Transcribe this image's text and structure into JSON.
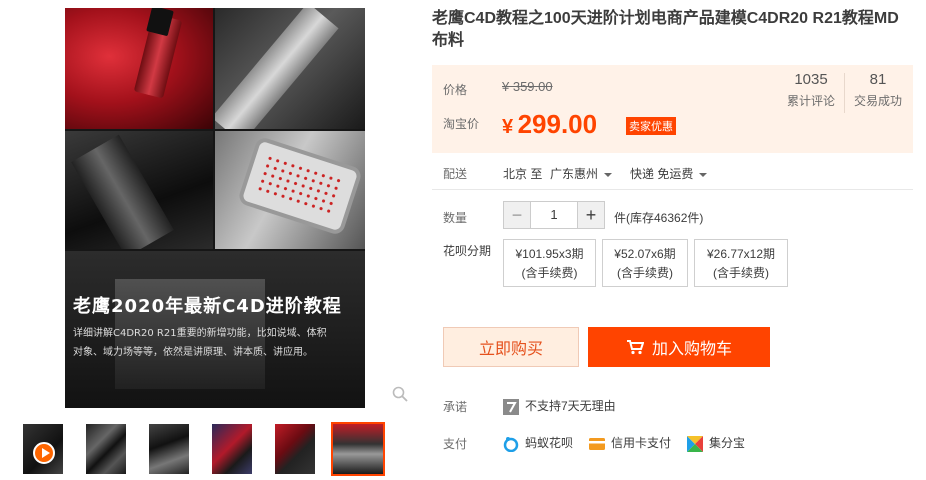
{
  "product": {
    "title": "老鹰C4D教程之100天进阶计划电商产品建模C4DR20 R21教程MD布料"
  },
  "gallery": {
    "banner_title": "老鹰2020年最新C4D进阶教程",
    "banner_sub_line1": "详细讲解C4DR20 R21重要的新增功能，比如说域、体积",
    "banner_sub_line2": "对象、域力场等等，依然是讲原理、讲本质、讲应用。",
    "thumbnail_count": 6,
    "active_thumbnail": 6
  },
  "price": {
    "label_price": "价格",
    "original": "¥ 359.00",
    "label_taobao": "淘宝价",
    "currency": "¥",
    "current": "299.00",
    "promo_badge": "卖家优惠",
    "accent_color": "#ff4400"
  },
  "stats": {
    "reviews_count": "1035",
    "reviews_label": "累计评论",
    "sales_count": "81",
    "sales_label": "交易成功"
  },
  "delivery": {
    "label": "配送",
    "from": "北京 至",
    "to": "广东惠州",
    "method": "快递 免运费"
  },
  "quantity": {
    "label": "数量",
    "minus": "−",
    "value": "1",
    "plus": "+",
    "stock": "件(库存46362件)"
  },
  "installment": {
    "label": "花呗分期",
    "options": [
      {
        "amount": "¥101.95x3期",
        "fee": "(含手续费)"
      },
      {
        "amount": "¥52.07x6期",
        "fee": "(含手续费)"
      },
      {
        "amount": "¥26.77x12期",
        "fee": "(含手续费)"
      }
    ]
  },
  "actions": {
    "buy_now": "立即购买",
    "add_to_cart": "加入购物车"
  },
  "promise": {
    "label": "承诺",
    "text": "不支持7天无理由"
  },
  "payment": {
    "label": "支付",
    "methods": [
      "蚂蚁花呗",
      "信用卡支付",
      "集分宝"
    ]
  }
}
